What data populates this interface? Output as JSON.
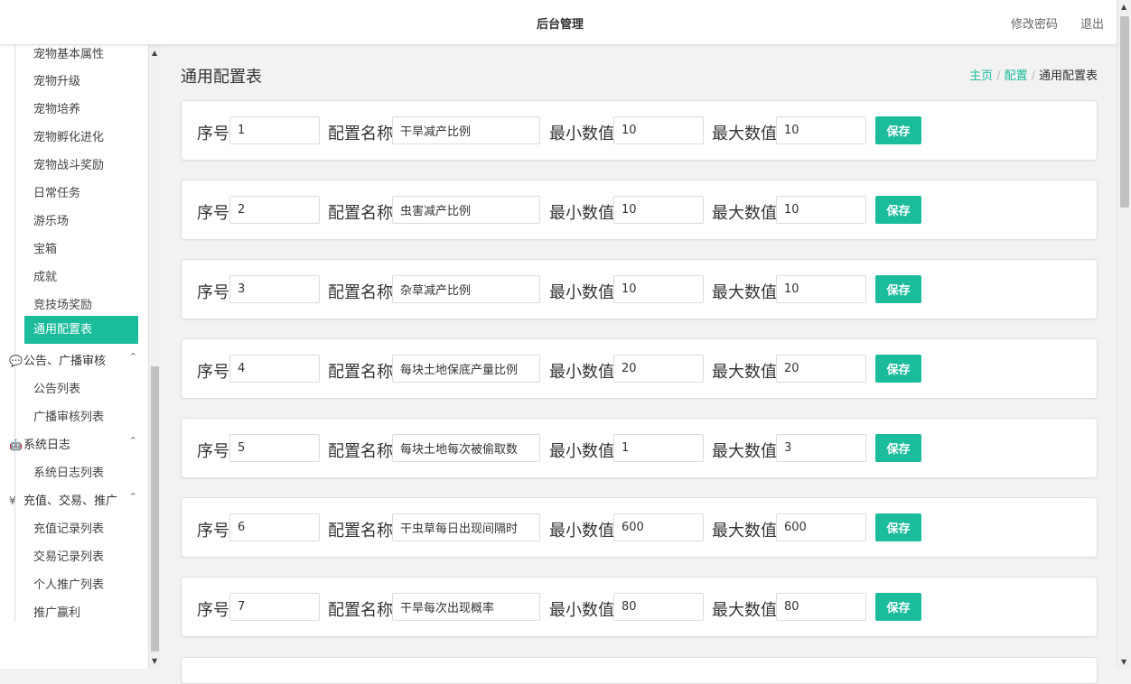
{
  "topbar": {
    "title": "后台管理",
    "change_password": "修改密码",
    "logout": "退出"
  },
  "sidebar": {
    "items": [
      {
        "label": "宠物基本属性"
      },
      {
        "label": "宠物升级"
      },
      {
        "label": "宠物培养"
      },
      {
        "label": "宠物孵化进化"
      },
      {
        "label": "宠物战斗奖励"
      },
      {
        "label": "日常任务"
      },
      {
        "label": "游乐场"
      },
      {
        "label": "宝箱"
      },
      {
        "label": "成就"
      },
      {
        "label": "竞技场奖励"
      },
      {
        "label": "通用配置表",
        "active": true
      }
    ],
    "groups": [
      {
        "label": "公告、广播审核",
        "icon": "chat-bubble-icon",
        "glyph": "💬",
        "items": [
          "公告列表",
          "广播审核列表"
        ]
      },
      {
        "label": "系统日志",
        "icon": "android-icon",
        "glyph": "🤖",
        "items": [
          "系统日志列表"
        ]
      },
      {
        "label": "充值、交易、推广",
        "icon": "yen-icon",
        "glyph": "¥",
        "items": [
          "充值记录列表",
          "交易记录列表",
          "个人推广列表",
          "推广赢利"
        ]
      }
    ]
  },
  "page": {
    "title": "通用配置表",
    "breadcrumb": {
      "home": "主页",
      "config": "配置",
      "current": "通用配置表",
      "separator": "/"
    }
  },
  "labels": {
    "index": "序号",
    "name": "配置名称",
    "min": "最小数值",
    "max": "最大数值",
    "save": "保存"
  },
  "rows": [
    {
      "index": "1",
      "name": "干旱减产比例",
      "min": "10",
      "max": "10"
    },
    {
      "index": "2",
      "name": "虫害减产比例",
      "min": "10",
      "max": "10"
    },
    {
      "index": "3",
      "name": "杂草减产比例",
      "min": "10",
      "max": "10"
    },
    {
      "index": "4",
      "name": "每块土地保底产量比例",
      "min": "20",
      "max": "20"
    },
    {
      "index": "5",
      "name": "每块土地每次被偷取数",
      "min": "1",
      "max": "3"
    },
    {
      "index": "6",
      "name": "干虫草每日出现间隔时",
      "min": "600",
      "max": "600"
    },
    {
      "index": "7",
      "name": "干旱每次出现概率",
      "min": "80",
      "max": "80"
    }
  ],
  "colors": {
    "accent": "#1abc9c",
    "background": "#f2f2f2"
  }
}
